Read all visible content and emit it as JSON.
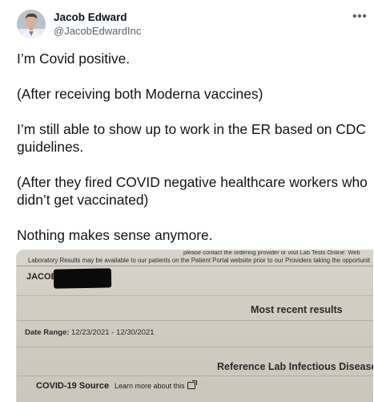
{
  "tweet": {
    "author_name": "Jacob Edward",
    "author_handle": "@JacobEdwardInc",
    "more_icon": "•••",
    "paragraphs": [
      "I’m Covid positive.",
      "(After receiving both Moderna vaccines)",
      "I’m still able to show up to work in the ER based on CDC guidelines.",
      "(After they fired COVID negative healthcare workers who didn’t get vaccinated)",
      "Nothing makes sense anymore."
    ]
  },
  "photo": {
    "top_line_fragment": "please contact the ordering provider or visit Lab Tests Online: Web",
    "notice": "Laboratory Results may be available to our patients on the Patient Portal website prior to our Providers taking the opportunit",
    "patient_first_name": "JACOB",
    "section_title": "Most recent results",
    "date_range_label": "Date Range:",
    "date_range_value": "12/23/2021 - 12/30/2021",
    "lab_title": "Reference Lab Infectious Disease",
    "source_label": "COVID-19 Source",
    "learn_more": "Learn more about this"
  }
}
